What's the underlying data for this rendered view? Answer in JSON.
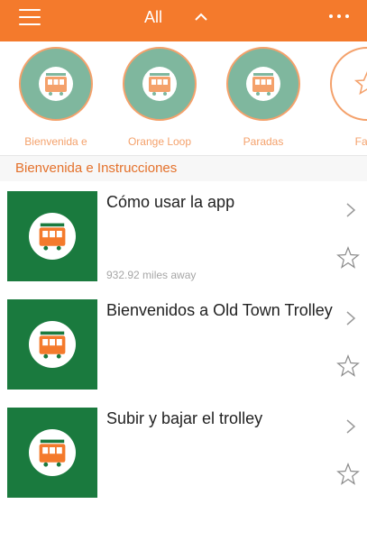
{
  "header": {
    "filter_label": "All"
  },
  "categories": [
    {
      "label": "Bienvenida e",
      "icon": "trolley-icon"
    },
    {
      "label": "Orange Loop",
      "icon": "trolley-icon"
    },
    {
      "label": "Paradas",
      "icon": "trolley-icon"
    },
    {
      "label": "Favo",
      "icon": "star-icon"
    }
  ],
  "section": {
    "title": "Bienvenida e Instrucciones"
  },
  "items": [
    {
      "title": "Cómo usar la app",
      "distance": "932.92 miles away"
    },
    {
      "title": "Bienvenidos a Old Town Trolley",
      "distance": ""
    },
    {
      "title": "Subir y bajar el trolley",
      "distance": ""
    }
  ],
  "colors": {
    "accent": "#f47a2c",
    "category_circle": "#7fb79e",
    "thumb_bg": "#1a7a3e",
    "label": "#f4a16b"
  }
}
